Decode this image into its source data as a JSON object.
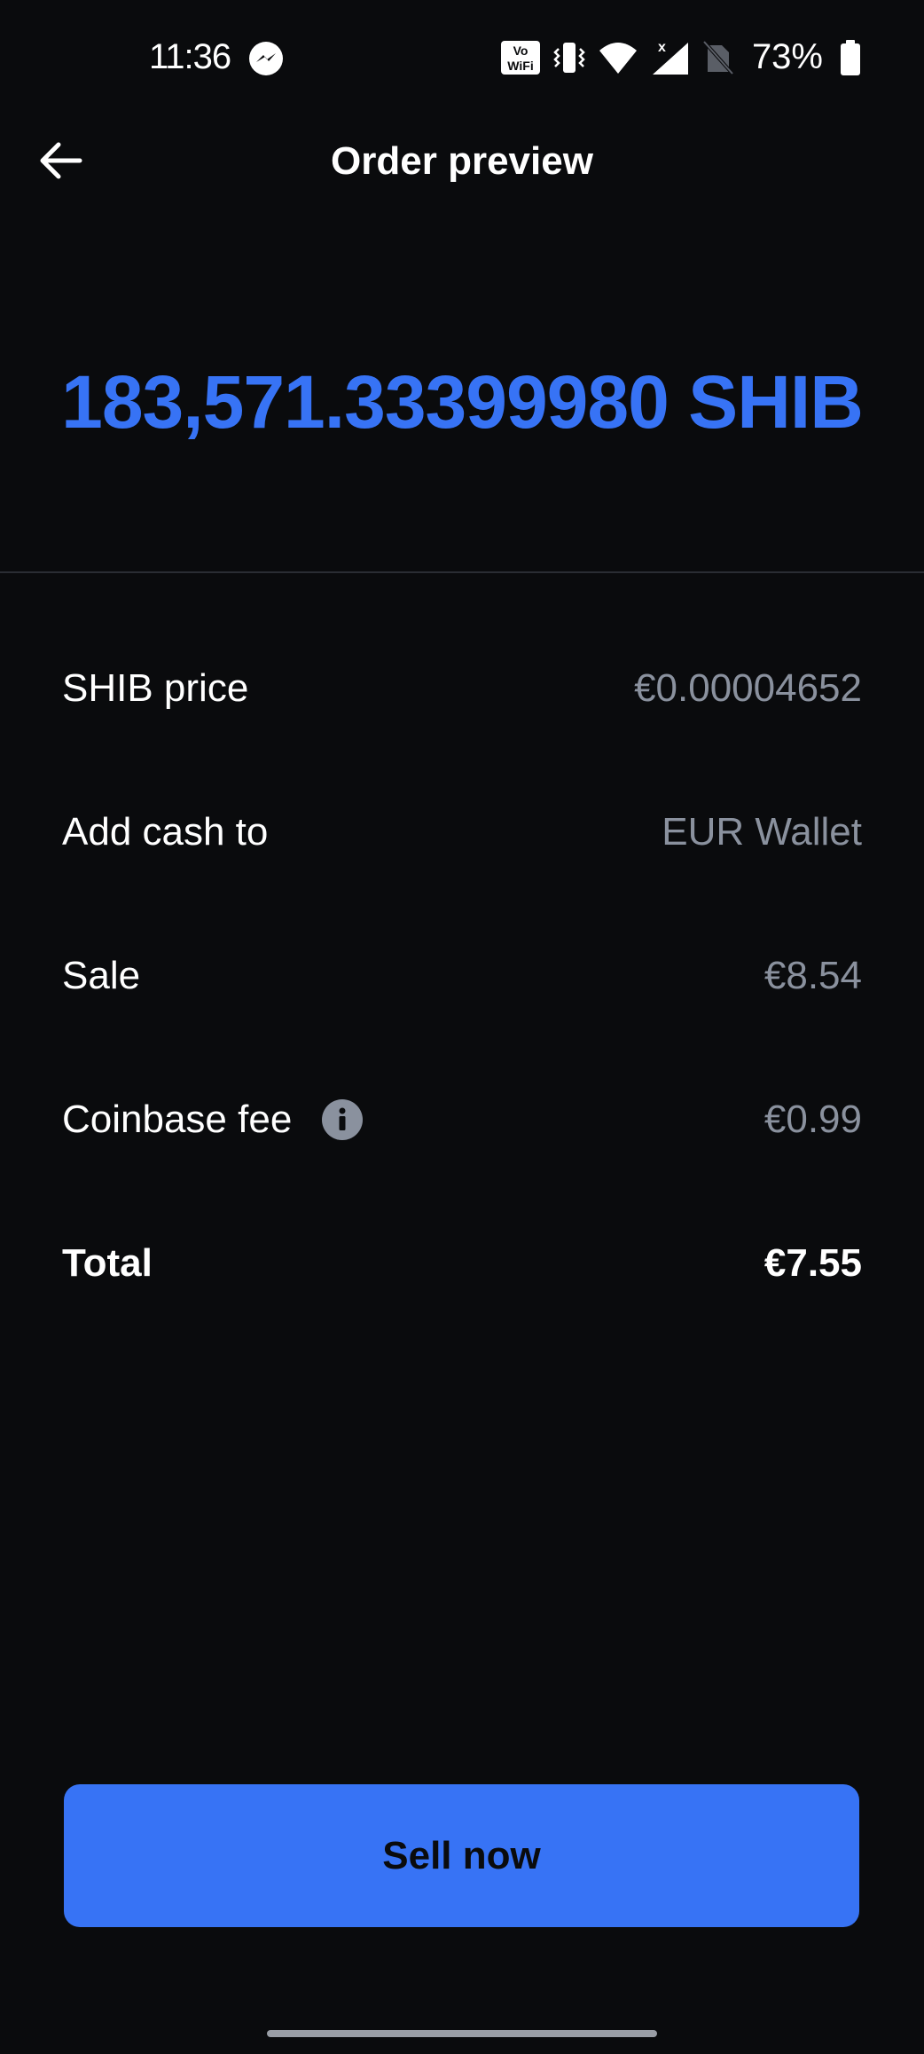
{
  "status_bar": {
    "time": "11:36",
    "battery_percent": "73%",
    "icons": [
      "messenger-icon",
      "vowifi-icon",
      "vibrate-icon",
      "wifi-icon",
      "signal-icon",
      "no-sim-icon",
      "battery-icon"
    ]
  },
  "header": {
    "title": "Order preview",
    "back_icon": "arrow-left-icon"
  },
  "amount": {
    "text": "183,571.33399980 SHIB"
  },
  "details": {
    "price": {
      "label": "SHIB price",
      "value": "€0.00004652"
    },
    "destination": {
      "label": "Add cash to",
      "value": "EUR Wallet"
    },
    "sale": {
      "label": "Sale",
      "value": "€8.54"
    },
    "fee": {
      "label": "Coinbase fee",
      "value": "€0.99",
      "icon": "info-icon"
    },
    "total": {
      "label": "Total",
      "value": "€7.55"
    }
  },
  "actions": {
    "sell_label": "Sell now"
  },
  "colors": {
    "background": "#0a0b0d",
    "accent": "#3773f5",
    "muted_text": "#8a919e"
  }
}
